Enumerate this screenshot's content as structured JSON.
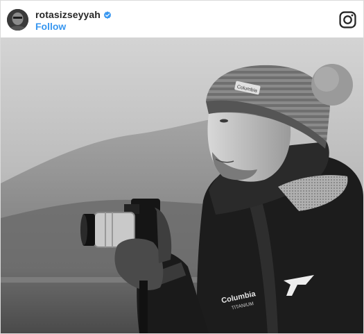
{
  "post": {
    "username": "rotasizseyyah",
    "verified": true,
    "follow_label": "Follow",
    "platform_icon": "instagram-icon"
  },
  "photo": {
    "hat_brand": "Columbia",
    "jacket_brand": "Columbia",
    "jacket_sub": "TITANIUM"
  },
  "colors": {
    "follow": "#3897f0",
    "verified": "#3897f0",
    "username": "#262626"
  }
}
